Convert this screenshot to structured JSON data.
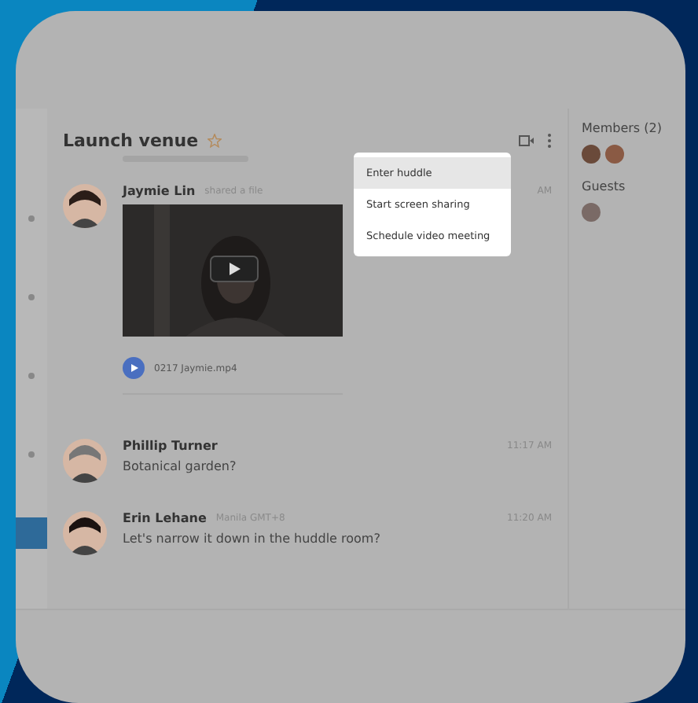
{
  "channel": {
    "title": "Launch venue",
    "starred": false
  },
  "messages": [
    {
      "author": "Jaymie Lin",
      "note": "shared a file",
      "time": "AM",
      "file": {
        "name": "0217 Jaymie.mp4"
      }
    },
    {
      "author": "Phillip Turner",
      "time": "11:17 AM",
      "text": "Botanical garden?"
    },
    {
      "author": "Erin Lehane",
      "status": "Manila GMT+8",
      "time": "11:20 AM",
      "text": "Let's narrow it down in the huddle room?"
    }
  ],
  "menu": [
    {
      "label": "Enter huddle",
      "selected": true
    },
    {
      "label": "Start screen sharing",
      "selected": false
    },
    {
      "label": "Schedule video meeting",
      "selected": false
    }
  ],
  "members": {
    "title": "Members (2)",
    "guests_title": "Guests"
  },
  "sidebar": [
    {
      "selected": false
    },
    {
      "selected": false
    },
    {
      "selected": false
    },
    {
      "selected": false
    },
    {
      "selected": true
    }
  ]
}
